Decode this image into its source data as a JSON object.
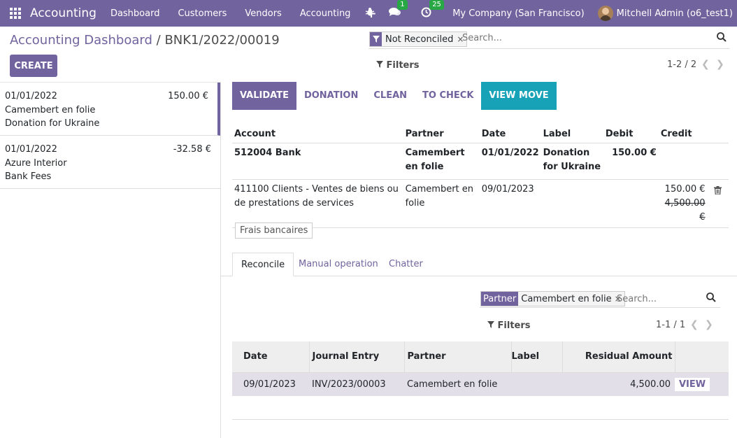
{
  "navbar": {
    "app_name": "Accounting",
    "menu": [
      "Dashboard",
      "Customers",
      "Vendors",
      "Accounting"
    ],
    "chat_count": "1",
    "activity_count": "25",
    "company": "My Company (San Francisco)",
    "user": "Mitchell Admin (o6_test1)"
  },
  "breadcrumb": {
    "parent": "Accounting Dashboard",
    "separator": "/",
    "current": "BNK1/2022/00019"
  },
  "create_label": "CREATE",
  "search": {
    "facet_value": "Not Reconciled",
    "placeholder": "Search..."
  },
  "filters_label": "Filters",
  "pager": "1-2 / 2",
  "statements": [
    {
      "date": "01/01/2022",
      "amount": "150.00 €",
      "partner": "Camembert en folie",
      "label": "Donation for Ukraine"
    },
    {
      "date": "01/01/2022",
      "amount": "-32.58 €",
      "partner": "Azure Interior",
      "label": "Bank Fees"
    }
  ],
  "actions": {
    "validate": "VALIDATE",
    "donation": "DONATION",
    "clean": "CLEAN",
    "to_check": "TO CHECK",
    "view_move": "VIEW MOVE"
  },
  "lines": {
    "headers": {
      "account": "Account",
      "partner": "Partner",
      "date": "Date",
      "label": "Label",
      "debit": "Debit",
      "credit": "Credit"
    },
    "rows": [
      {
        "account": "512004 Bank",
        "partner": "Camembert en folie",
        "date": "01/01/2022",
        "label": "Donation for Ukraine",
        "debit": "150.00 €",
        "credit": "",
        "credit_old": ""
      },
      {
        "account": "411100 Clients - Ventes de biens ou de prestations de services",
        "partner": "Camembert en folie",
        "date": "09/01/2023",
        "label": "",
        "debit": "",
        "credit": "150.00 €",
        "credit_old": "4,500.00 €"
      }
    ]
  },
  "frais_label": "Frais bancaires",
  "tabs": {
    "reconcile": "Reconcile",
    "manual": "Manual operation",
    "chatter": "Chatter"
  },
  "reconcile": {
    "facet_label": "Partner",
    "facet_value": "Camembert en folie",
    "placeholder": "Search...",
    "filters_label": "Filters",
    "pager": "1-1 / 1",
    "headers": {
      "date": "Date",
      "journal_entry": "Journal Entry",
      "partner": "Partner",
      "label": "Label",
      "residual": "Residual Amount"
    },
    "rows": [
      {
        "date": "09/01/2023",
        "journal_entry": "INV/2023/00003",
        "partner": "Camembert en folie",
        "label": "",
        "residual": "4,500.00",
        "action": "VIEW"
      }
    ]
  },
  "colors": {
    "brand": "#71639e",
    "view_move": "#17a2b8",
    "badge": "#28a745"
  }
}
